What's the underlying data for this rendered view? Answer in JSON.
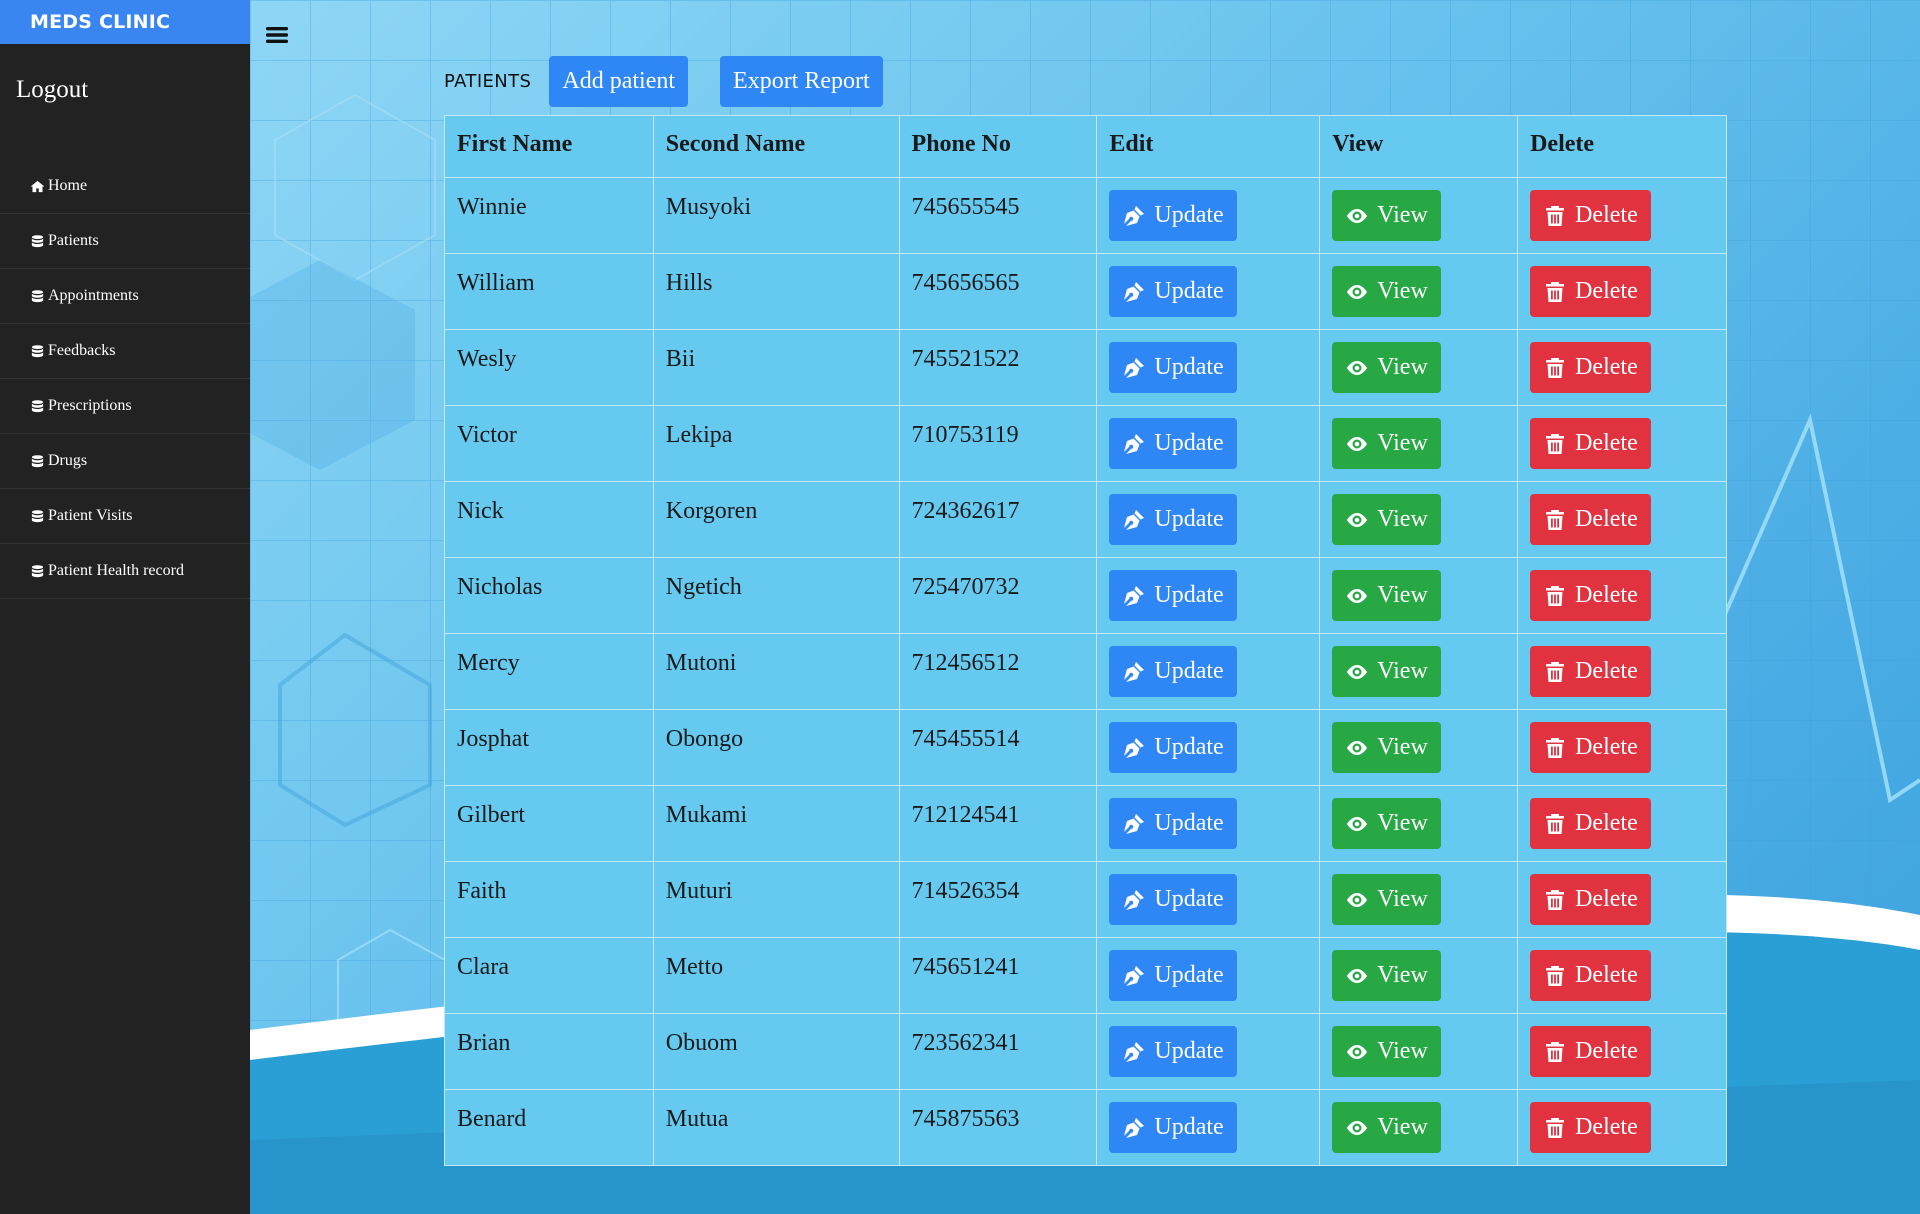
{
  "sidebar": {
    "brand": "MEDS CLINIC",
    "logout": "Logout",
    "items": [
      {
        "label": "Home",
        "icon": "home-icon"
      },
      {
        "label": "Patients",
        "icon": "database-icon"
      },
      {
        "label": "Appointments",
        "icon": "database-icon"
      },
      {
        "label": "Feedbacks",
        "icon": "database-icon"
      },
      {
        "label": "Prescriptions",
        "icon": "database-icon"
      },
      {
        "label": "Drugs",
        "icon": "database-icon"
      },
      {
        "label": "Patient Visits",
        "icon": "database-icon"
      },
      {
        "label": "Patient Health record",
        "icon": "database-icon"
      }
    ]
  },
  "toolbar": {
    "section_label": "PATIENTS",
    "add_label": "Add patient",
    "export_label": "Export Report"
  },
  "table": {
    "headers": [
      "First Name",
      "Second Name",
      "Phone No",
      "Edit",
      "View",
      "Delete"
    ],
    "update_label": "Update",
    "view_label": "View",
    "delete_label": "Delete",
    "rows": [
      {
        "first": "Winnie",
        "second": "Musyoki",
        "phone": "745655545"
      },
      {
        "first": "William",
        "second": "Hills",
        "phone": "745656565"
      },
      {
        "first": "Wesly",
        "second": "Bii",
        "phone": "745521522"
      },
      {
        "first": "Victor",
        "second": "Lekipa",
        "phone": "710753119"
      },
      {
        "first": "Nick",
        "second": "Korgoren",
        "phone": "724362617"
      },
      {
        "first": "Nicholas",
        "second": "Ngetich",
        "phone": "725470732"
      },
      {
        "first": "Mercy",
        "second": "Mutoni",
        "phone": "712456512"
      },
      {
        "first": "Josphat",
        "second": "Obongo",
        "phone": "745455514"
      },
      {
        "first": "Gilbert",
        "second": "Mukami",
        "phone": "712124541"
      },
      {
        "first": "Faith",
        "second": "Muturi",
        "phone": "714526354"
      },
      {
        "first": "Clara",
        "second": "Metto",
        "phone": "745651241"
      },
      {
        "first": "Brian",
        "second": "Obuom",
        "phone": "723562341"
      },
      {
        "first": "Benard",
        "second": "Mutua",
        "phone": "745875563"
      }
    ]
  },
  "colors": {
    "brand": "#3a86f0",
    "sidebar": "#222222",
    "primary": "#2f86f5",
    "success": "#28a745",
    "danger": "#e0323f",
    "table_bg": "#66c9f0"
  }
}
